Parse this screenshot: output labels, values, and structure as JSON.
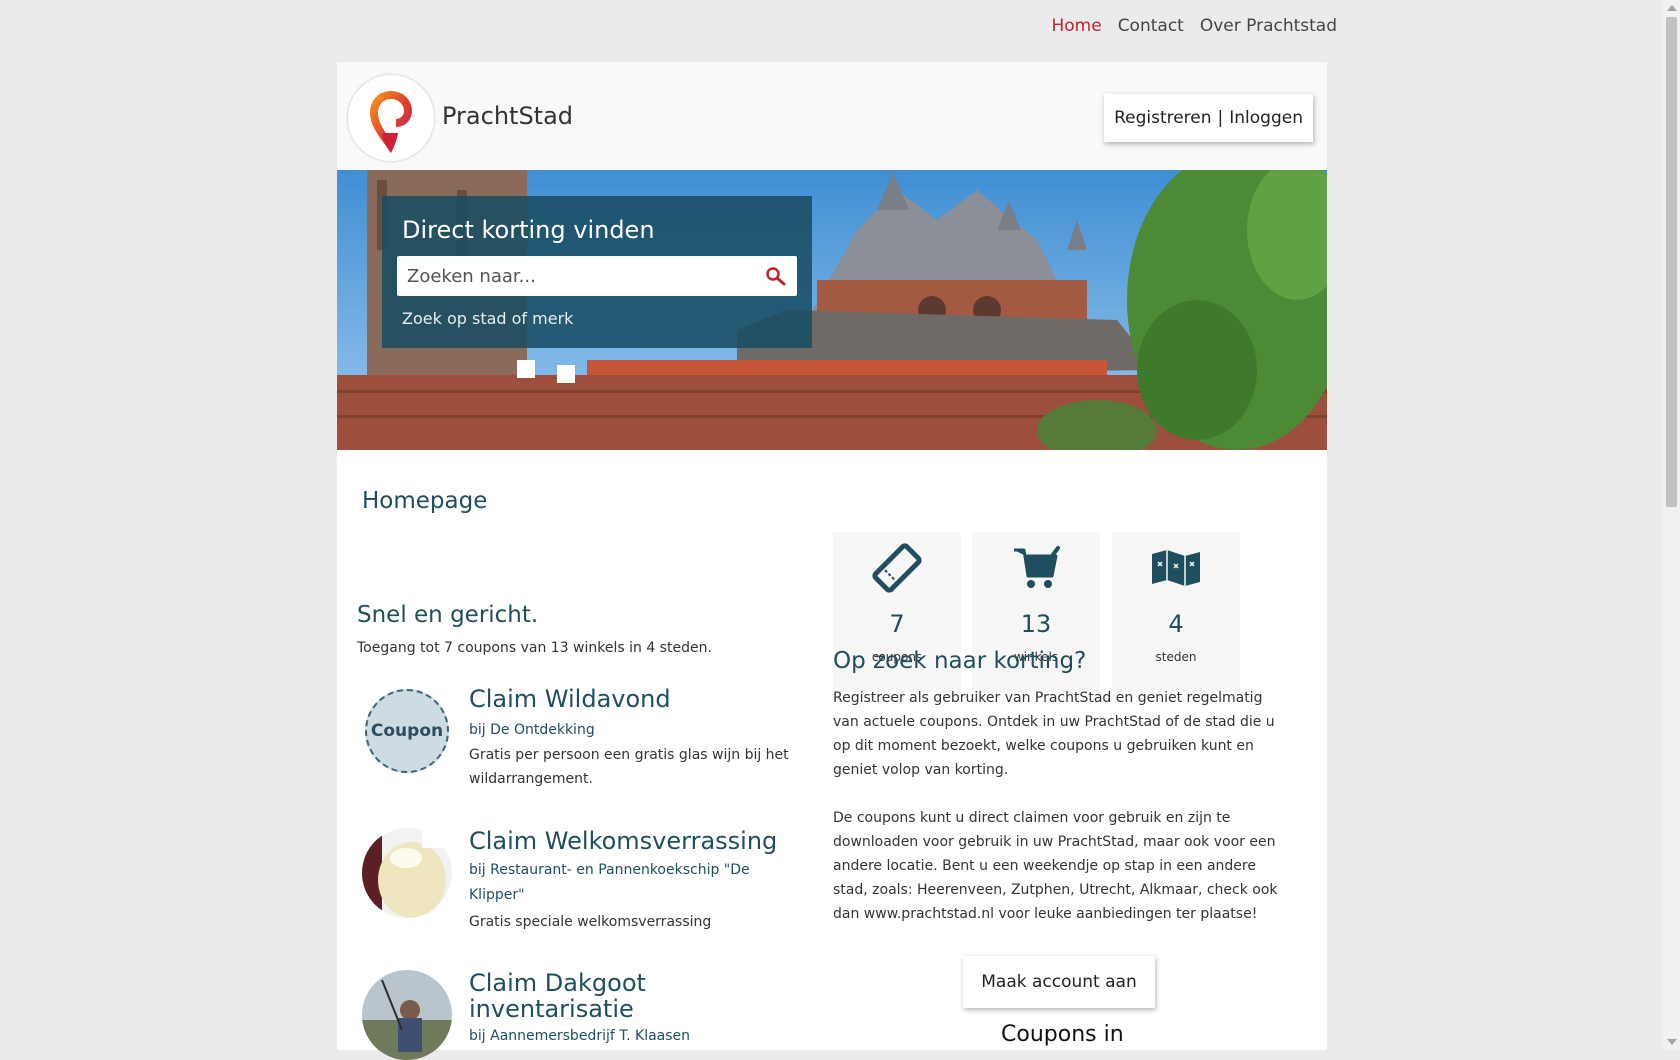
{
  "nav": {
    "items": [
      "Home",
      "Contact",
      "Over Prachtstad"
    ]
  },
  "header": {
    "site_name": "PrachtStad",
    "register": "Registreren",
    "separator": "|",
    "login": "Inloggen"
  },
  "search": {
    "title": "Direct korting vinden",
    "placeholder": "Zoeken naar...",
    "hint": "Zoek op stad of merk"
  },
  "main": {
    "page_title": "Homepage",
    "intro_heading": "Snel en gericht.",
    "intro_text": "Toegang tot 7 coupons van 13 winkels in 4 steden.",
    "coupons": [
      {
        "title": "Claim Wildavond",
        "shop": "bij De Ontdekking",
        "description": "Gratis per persoon een gratis glas wijn bij het wildarrangement.",
        "badge": "Coupon"
      },
      {
        "title": "Claim Welkomsverrassing",
        "shop": "bij Restaurant- en Pannenkoekschip \"De Klipper\"",
        "description": "Gratis speciale welkomsverrassing"
      },
      {
        "title": "Claim Dakgoot inventarisatie",
        "shop": "bij Aannemersbedrijf T. Klaasen",
        "description": ""
      }
    ]
  },
  "stats": [
    {
      "value": "7",
      "label": "coupons",
      "icon": "ticket-icon"
    },
    {
      "value": "13",
      "label": "winkels",
      "icon": "shopping-cart-icon"
    },
    {
      "value": "4",
      "label": "steden",
      "icon": "map-icon"
    }
  ],
  "side": {
    "heading": "Op zoek naar korting?",
    "para1": "Registreer als gebruiker van PrachtStad en geniet regelmatig van actuele coupons. Ontdek in uw PrachtStad of de stad die u op dit moment bezoekt, welke coupons u gebruiken kunt en geniet volop van korting.",
    "para2": "De coupons kunt u direct claimen voor gebruik en zijn te downloaden voor gebruik in uw PrachtStad, maar ook voor een andere locatie. Bent u een weekendje op stap in een andere stad, zoals: Heerenveen, Zutphen, Utrecht, Alkmaar, check ook dan www.prachtstad.nl voor leuke aanbiedingen ter plaatse!",
    "cta": "Maak account aan",
    "partial_heading": "Coupons in"
  },
  "colors": {
    "accent": "#c0242c",
    "primary": "#1f4e5f",
    "search_panel": "#174c62"
  }
}
